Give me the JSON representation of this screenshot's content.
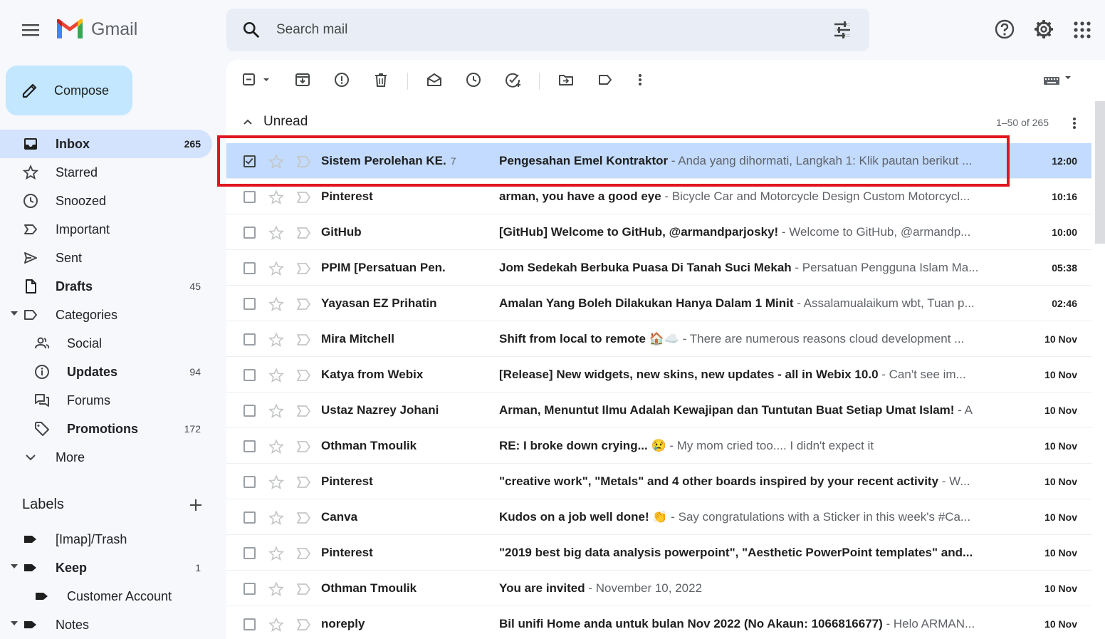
{
  "app": {
    "name": "Gmail"
  },
  "search": {
    "placeholder": "Search mail"
  },
  "compose": {
    "label": "Compose"
  },
  "nav": [
    {
      "label": "Inbox",
      "count": "265",
      "icon": "inbox-icon",
      "active": true,
      "bold": true
    },
    {
      "label": "Starred",
      "count": "",
      "icon": "star-icon"
    },
    {
      "label": "Snoozed",
      "count": "",
      "icon": "clock-icon"
    },
    {
      "label": "Important",
      "count": "",
      "icon": "important-icon"
    },
    {
      "label": "Sent",
      "count": "",
      "icon": "send-icon"
    },
    {
      "label": "Drafts",
      "count": "45",
      "icon": "draft-icon",
      "bold": true
    },
    {
      "label": "Categories",
      "count": "",
      "icon": "label-outline-icon",
      "caret": true
    },
    {
      "label": "Social",
      "count": "",
      "icon": "people-icon",
      "sub": true
    },
    {
      "label": "Updates",
      "count": "94",
      "icon": "info-icon",
      "sub": true,
      "bold": true
    },
    {
      "label": "Forums",
      "count": "",
      "icon": "forum-icon",
      "sub": true
    },
    {
      "label": "Promotions",
      "count": "172",
      "icon": "tag-icon",
      "sub": true,
      "bold": true
    },
    {
      "label": "More",
      "count": "",
      "icon": "chevron-down-icon"
    }
  ],
  "labels": {
    "heading": "Labels",
    "items": [
      {
        "label": "[Imap]/Trash",
        "count": ""
      },
      {
        "label": "Keep",
        "count": "1",
        "caret": true,
        "bold": true
      },
      {
        "label": "Customer Account",
        "count": "",
        "sub": true
      },
      {
        "label": "Notes",
        "count": "",
        "caret": true
      }
    ]
  },
  "list": {
    "section_title": "Unread",
    "pager": "1–50 of 265"
  },
  "emails": [
    {
      "sender": "Sistem Perolehan KE.",
      "count": "7",
      "subject": "Pengesahan Emel Kontraktor",
      "snippet": " - Anda yang dihormati, Langkah 1: Klik pautan berikut ...",
      "time": "12:00",
      "selected": true
    },
    {
      "sender": "Pinterest",
      "count": "",
      "subject": "arman, you have a good eye",
      "snippet": " - Bicycle Car and Motorcycle Design Custom Motorcycl...",
      "time": "10:16"
    },
    {
      "sender": "GitHub",
      "count": "",
      "subject": "[GitHub] Welcome to GitHub, @armandparjosky!",
      "snippet": " - Welcome to GitHub, @armandp...",
      "time": "10:00"
    },
    {
      "sender": "PPIM [Persatuan Pen.",
      "count": "",
      "subject": "Jom Sedekah Berbuka Puasa Di Tanah Suci Mekah",
      "snippet": " - Persatuan Pengguna Islam Ma...",
      "time": "05:38"
    },
    {
      "sender": "Yayasan EZ Prihatin",
      "count": "",
      "subject": "Amalan Yang Boleh Dilakukan Hanya Dalam 1 Minit",
      "snippet": " -  Assalamualaikum wbt, Tuan p...",
      "time": "02:46"
    },
    {
      "sender": "Mira Mitchell",
      "count": "",
      "subject": "Shift from local to remote 🏠☁️",
      "snippet": " - There are numerous reasons cloud development ...",
      "time": "10 Nov"
    },
    {
      "sender": "Katya from Webix",
      "count": "",
      "subject": "[Release] New widgets, new skins, new updates - all in Webix 10.0",
      "snippet": " - Can't see im...",
      "time": "10 Nov"
    },
    {
      "sender": "Ustaz Nazrey Johani",
      "count": "",
      "subject": "Arman, Menuntut Ilmu Adalah Kewajipan dan Tuntutan Buat Setiap Umat Islam!",
      "snippet": " - A",
      "time": "10 Nov"
    },
    {
      "sender": "Othman Tmoulik",
      "count": "",
      "subject": "RE: I broke down crying... 😢",
      "snippet": " - My mom cried too.... I didn't expect it",
      "time": "10 Nov"
    },
    {
      "sender": "Pinterest",
      "count": "",
      "subject": "\"creative work\", \"Metals\" and 4 other boards inspired by your recent activity",
      "snippet": " - W...",
      "time": "10 Nov"
    },
    {
      "sender": "Canva",
      "count": "",
      "subject": "Kudos on a job well done! 👏",
      "snippet": " - Say congratulations with a Sticker in this week's #Ca...",
      "time": "10 Nov"
    },
    {
      "sender": "Pinterest",
      "count": "",
      "subject": "\"2019 best big data analysis powerpoint\", \"Aesthetic PowerPoint templates\" and...",
      "snippet": "",
      "time": "10 Nov"
    },
    {
      "sender": "Othman Tmoulik",
      "count": "",
      "subject": "You are invited",
      "snippet": " - November 10, 2022",
      "time": "10 Nov"
    },
    {
      "sender": "noreply",
      "count": "",
      "subject": "Bil unifi Home anda untuk bulan Nov 2022 (No Akaun: 1066816677)",
      "snippet": " - Helo ARMAN...",
      "time": "10 Nov"
    }
  ],
  "colors": {
    "accent": "#c2e7ff",
    "active_nav": "#d3e3fd",
    "selected_row": "#c2dbff",
    "annotation": "#e0161e"
  }
}
